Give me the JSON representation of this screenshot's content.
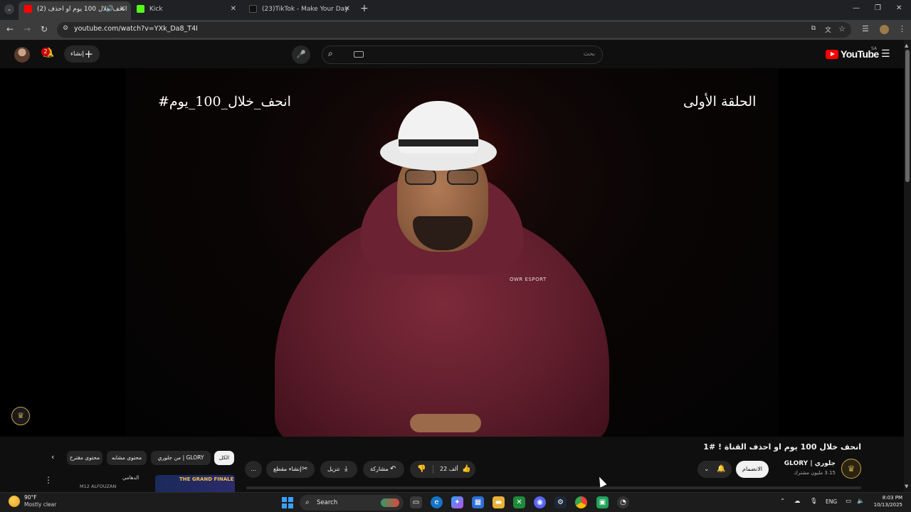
{
  "browser": {
    "tabs": [
      {
        "title": "(2) انحف خلال 100 يوم او احذف",
        "active": true
      },
      {
        "title": "Kick",
        "active": false
      },
      {
        "title": "(23)TikTok - Make Your Day",
        "active": false
      }
    ],
    "new_tab": "+",
    "url": "youtube.com/watch?v=YXk_Da8_T4I"
  },
  "masthead": {
    "notification_count": "2",
    "create_label": "إنشاء",
    "search_placeholder": "بحث",
    "logo_text": "YouTube",
    "region": "SA"
  },
  "video": {
    "overlay_left": "#انحف_خلال_100_يوم",
    "overlay_right": "الحلقة الأولى",
    "hoodie_logo": "OWR ESPORT"
  },
  "below": {
    "title": "انحف خلال 100 يوم او احذف القناة ! #1",
    "channel_name": "جلوري | GLORY",
    "channel_subs": "3.15 مليون مشترك",
    "join_label": "الانضمام",
    "like_count": "22 ألف",
    "share_label": "مشاركة",
    "download_label": "تنزيل",
    "clip_label": "إنشاء مقطع",
    "more_label": "...",
    "chips": [
      {
        "label": "الكل",
        "selected": true
      },
      {
        "label": "من جلوري | GLORY",
        "selected": false
      },
      {
        "label": "محتوى مشابه",
        "selected": false
      },
      {
        "label": "محتوى مقترح",
        "selected": false
      }
    ],
    "rec_channel": "الدهامي",
    "rec_thumb_text": "THE GRAND FINALE",
    "rec_sub": "M12 ALFOUZAN"
  },
  "taskbar": {
    "weather_temp": "90°F",
    "weather_desc": "Mostly clear",
    "search_label": "Search",
    "lang": "ENG",
    "time": "8:03 PM",
    "date": "10/13/2025"
  },
  "colors": {
    "youtube_red": "#ff0000",
    "background": "#0f0f0f",
    "chip_bg": "#272727"
  }
}
